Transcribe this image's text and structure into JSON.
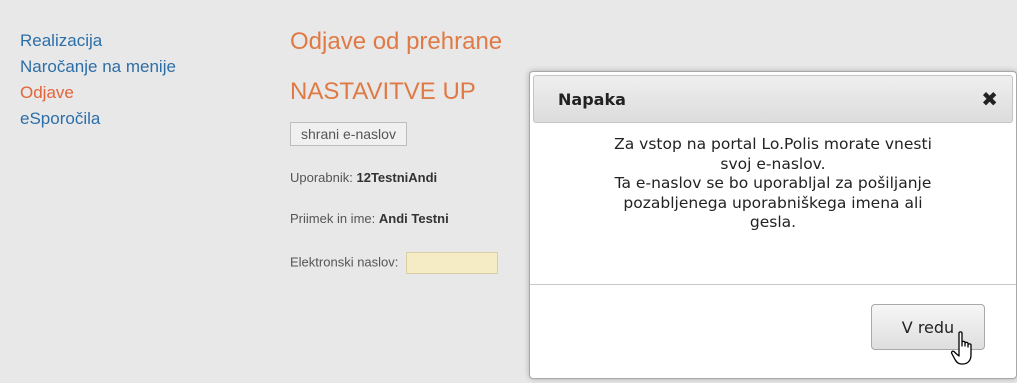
{
  "sidebar": {
    "items": [
      {
        "label": "Realizacija"
      },
      {
        "label": "Naročanje na menije"
      },
      {
        "label": "Odjave"
      },
      {
        "label": "eSporočila"
      }
    ]
  },
  "main": {
    "title": "Odjave od prehrane",
    "subtitle": "NASTAVITVE UP",
    "save_button": "shrani e-naslov",
    "user_label": "Uporabnik:",
    "user_value": "12TestniAndi",
    "name_label": "Priimek in ime:",
    "name_value": "Andi Testni",
    "email_label": "Elektronski naslov:"
  },
  "dialog": {
    "title": "Napaka",
    "close_glyph": "✖",
    "message_lines": [
      "Za vstop na portal Lo.Polis morate vnesti",
      "svoj e-naslov.",
      "Ta e-naslov se bo uporabljal za pošiljanje",
      "pozabljenega uporabniškega imena ali",
      "gesla."
    ],
    "ok_button": "V redu"
  }
}
